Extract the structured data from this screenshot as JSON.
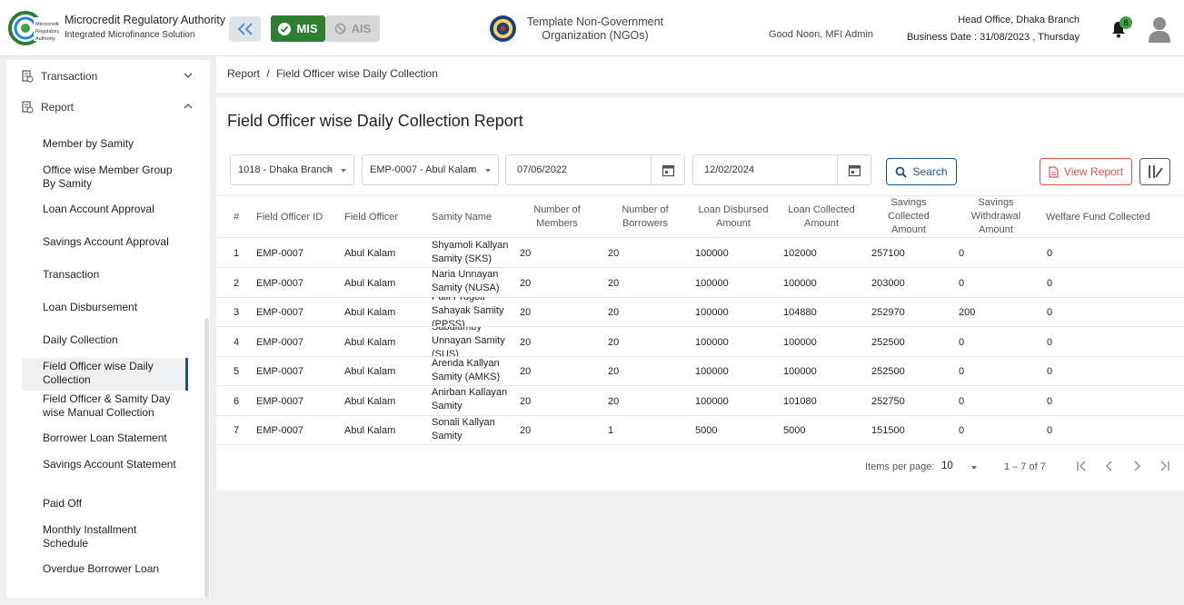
{
  "header": {
    "brand_title": "Microcredit Regulatory Authority",
    "brand_subtitle": "Integrated Microfinance Solution",
    "mis_label": "MIS",
    "ais_label": "AIS",
    "org_line1": "Template Non-Government",
    "org_line2": "Organization (NGOs)",
    "greeting": "Good Noon, MFI Admin",
    "branch": "Head Office, Dhaka Branch",
    "business_date": "Business Date : 31/08/2023 , Thursday",
    "notification_count": "8",
    "colors": {
      "primary": "#1e4f8c",
      "mis_green": "#2e7d32",
      "report_red": "#d9534f"
    }
  },
  "sidebar": {
    "groups": [
      {
        "label": "Transaction",
        "icon": "document-icon",
        "expanded": false
      },
      {
        "label": "Report",
        "icon": "document-icon",
        "expanded": true
      }
    ],
    "items": [
      "Member by Samity",
      "Office wise Member Group By Samity",
      "Loan Account Approval",
      "Savings Account Approval",
      "Transaction",
      "Loan Disbursement",
      "Daily Collection",
      "Field Officer wise Daily Collection",
      "Field Officer & Samity Day wise Manual Collection",
      "Borrower Loan Statement",
      "Savings Account Statement",
      "Paid Off",
      "Monthly Installment Schedule",
      "Overdue Borrower Loan"
    ],
    "active_item": "Field Officer wise Daily Collection"
  },
  "breadcrumb": {
    "parent": "Report",
    "separator": "/",
    "current": "Field Officer wise Daily Collection"
  },
  "page_title": "Field Officer wise Daily Collection Report",
  "filters": {
    "branch": "1018 - Dhaka Branch",
    "officer": "EMP-0007 - Abul Kalam",
    "from_date": "07/06/2022",
    "to_date": "12/02/2024",
    "search_label": "Search",
    "view_report_label": "View Report"
  },
  "table": {
    "headers": [
      "#",
      "Field Officer ID",
      "Field Officer",
      "Samity Name",
      "Number of Members",
      "Number of Borrowers",
      "Loan Disbursed Amount",
      "Loan Collected Amount",
      "Savings Collected Amount",
      "Savings Withdrawal Amount",
      "Welfare Fund Collected"
    ],
    "rows": [
      [
        "1",
        "EMP-0007",
        "Abul Kalam",
        "Shyamoli Kallyan Samity (SKS)",
        "20",
        "20",
        "100000",
        "102000",
        "257100",
        "0",
        "0"
      ],
      [
        "2",
        "EMP-0007",
        "Abul Kalam",
        "Naria Unnayan Samity (NUSA)",
        "20",
        "20",
        "100000",
        "100000",
        "203000",
        "0",
        "0"
      ],
      [
        "3",
        "EMP-0007",
        "Abul Kalam",
        "Palli Progoti Sahayak Samity (PPSS)",
        "20",
        "20",
        "100000",
        "104880",
        "252970",
        "200",
        "0"
      ],
      [
        "4",
        "EMP-0007",
        "Abul Kalam",
        "Sabalamby Unnayan Samity (SUS)",
        "20",
        "20",
        "100000",
        "100000",
        "252500",
        "0",
        "0"
      ],
      [
        "5",
        "EMP-0007",
        "Abul Kalam",
        "Arenda Kallyan Samity (AMKS)",
        "20",
        "20",
        "100000",
        "100000",
        "252500",
        "0",
        "0"
      ],
      [
        "6",
        "EMP-0007",
        "Abul Kalam",
        "Anirban Kallayan Samity",
        "20",
        "20",
        "100000",
        "101080",
        "252750",
        "0",
        "0"
      ],
      [
        "7",
        "EMP-0007",
        "Abul Kalam",
        "Sonali Kallyan Samity",
        "20",
        "1",
        "5000",
        "5000",
        "151500",
        "0",
        "0"
      ]
    ]
  },
  "pagination": {
    "items_per_page_label": "Items per page:",
    "page_size": "10",
    "range": "1 – 7 of 7"
  }
}
